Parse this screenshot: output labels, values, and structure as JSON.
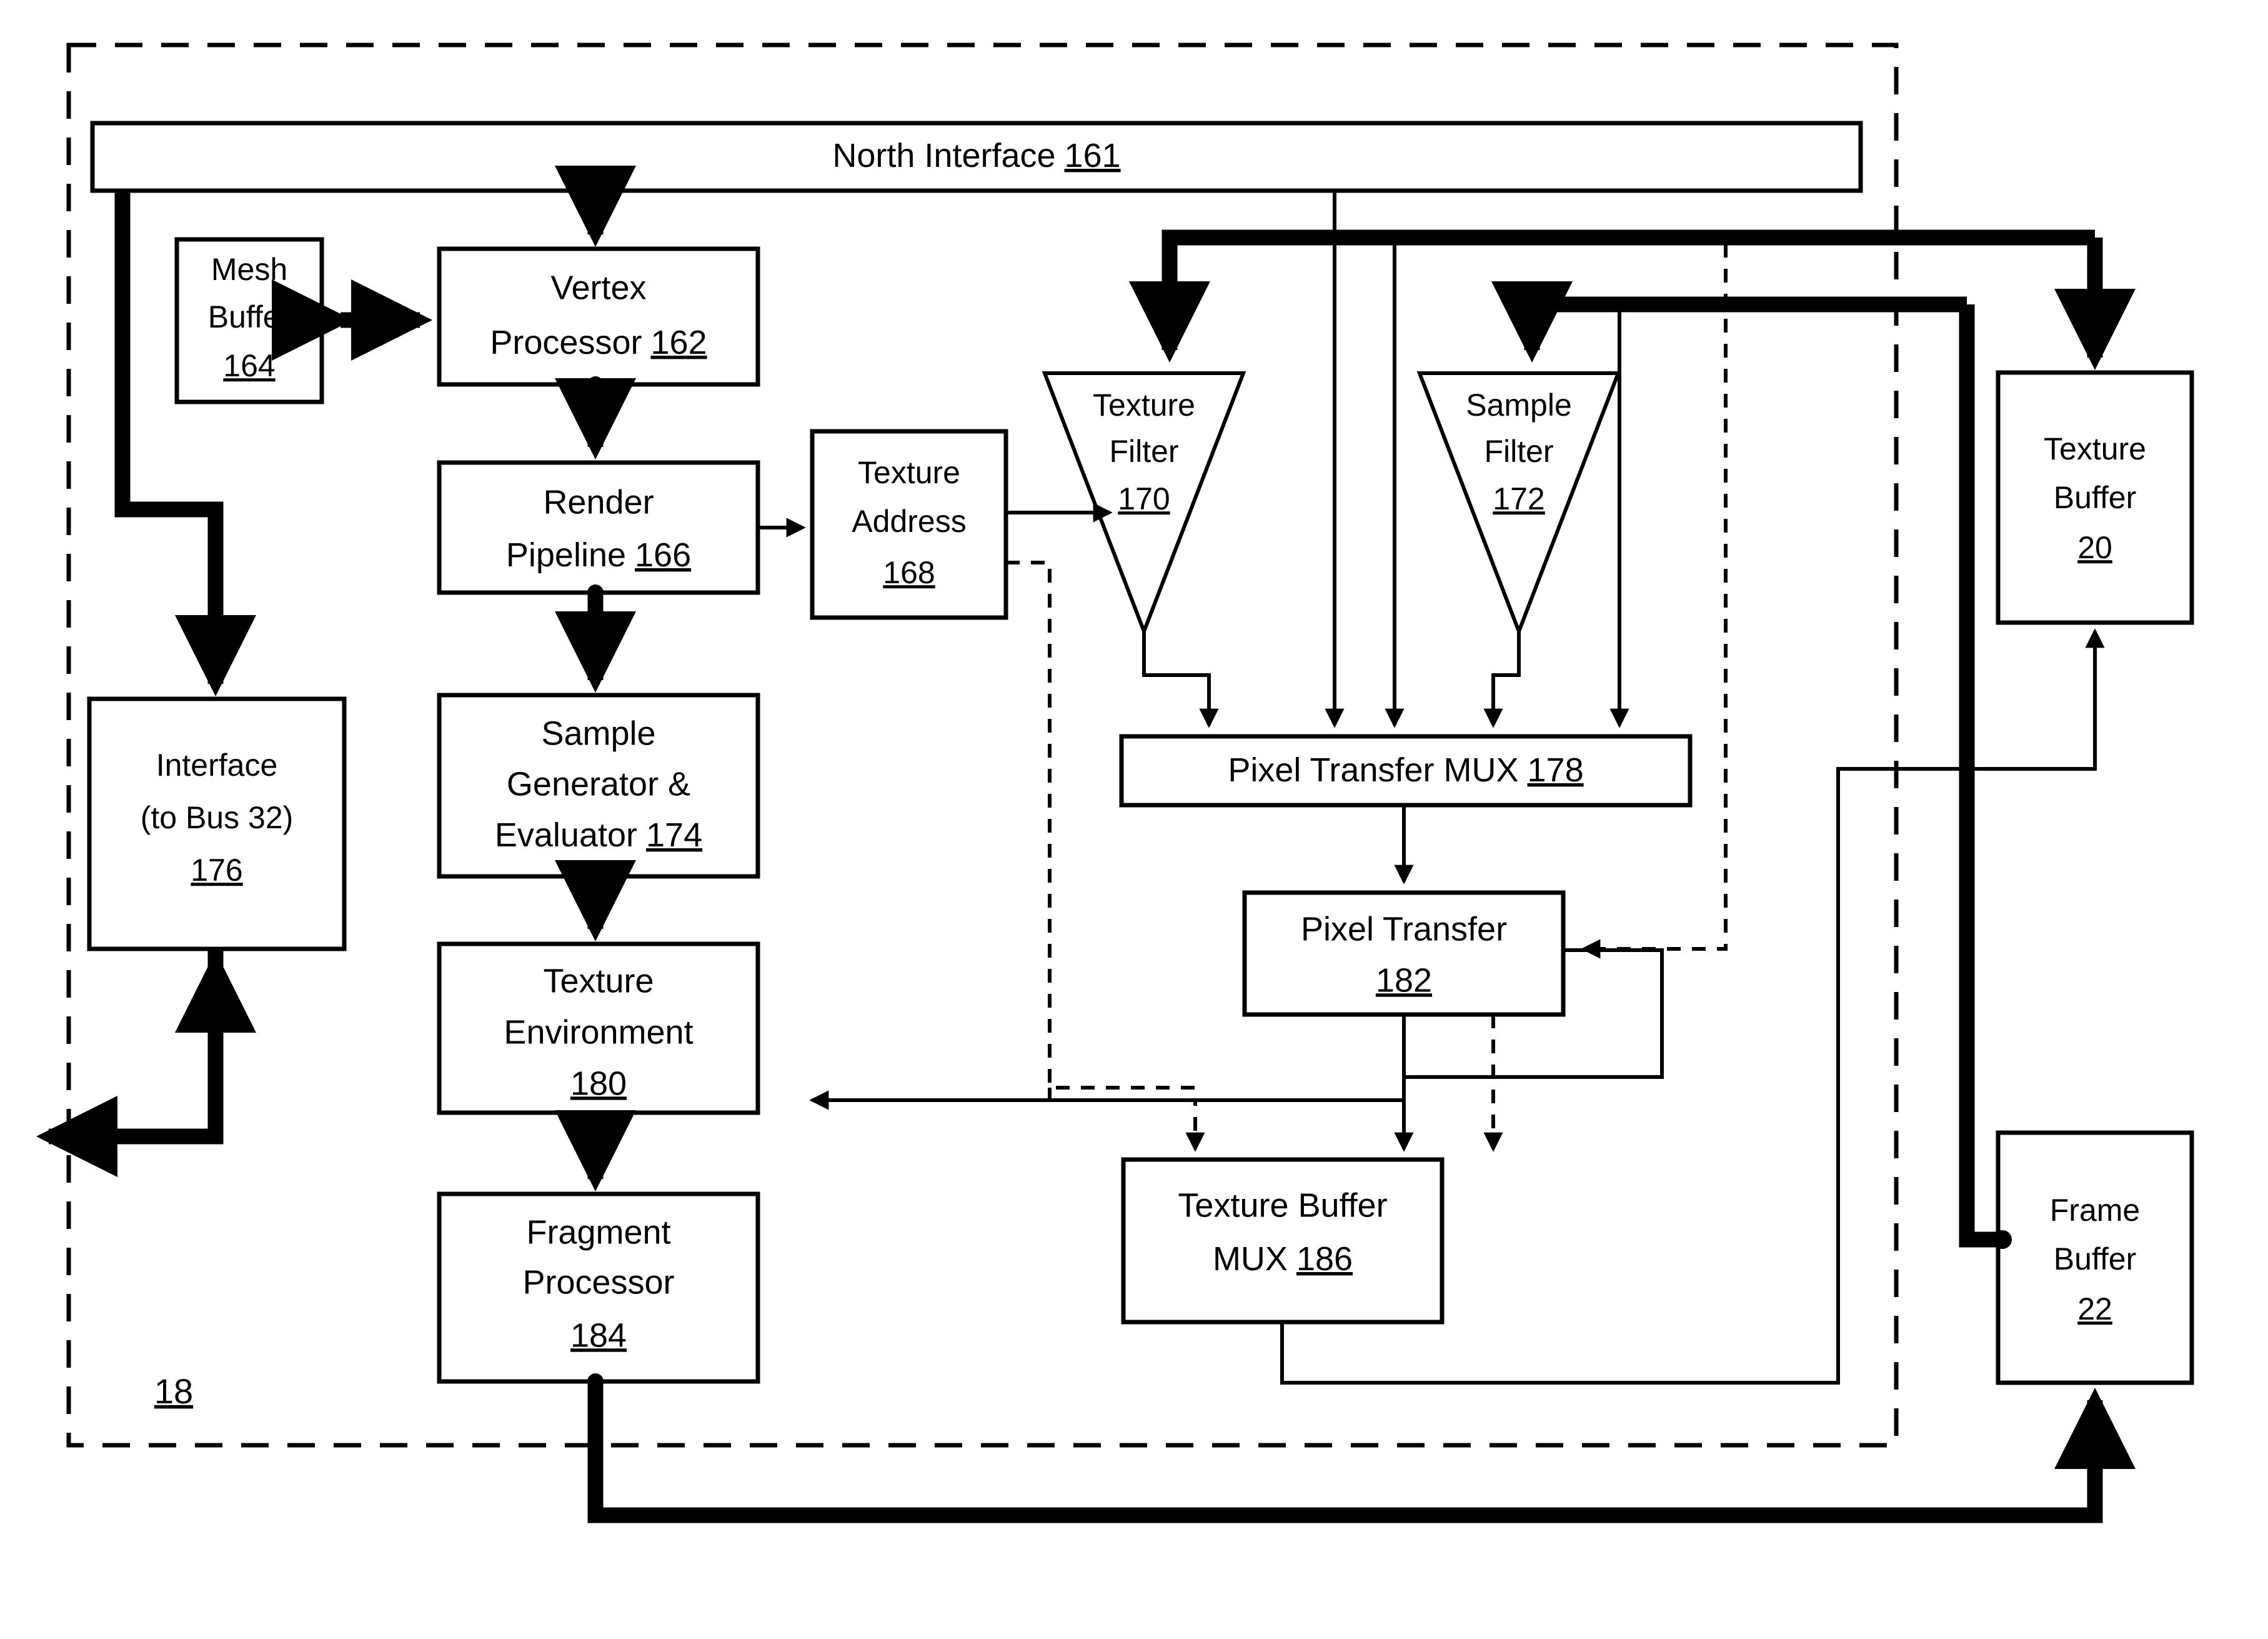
{
  "figure": {
    "container_label": "18",
    "container_style": "dashed"
  },
  "blocks": {
    "north_interface": {
      "line1": "North Interface",
      "ref": "161"
    },
    "mesh_buffer": {
      "line1": "Mesh",
      "line2": "Buffer",
      "ref": "164"
    },
    "vertex_processor": {
      "line1": "Vertex",
      "line2": "Processor",
      "ref": "162"
    },
    "render_pipeline": {
      "line1": "Render",
      "line2": "Pipeline",
      "ref": "166"
    },
    "texture_address": {
      "line1": "Texture",
      "line2": "Address",
      "ref": "168"
    },
    "texture_filter": {
      "line1": "Texture",
      "line2": "Filter",
      "ref": "170"
    },
    "sample_filter": {
      "line1": "Sample",
      "line2": "Filter",
      "ref": "172"
    },
    "texture_buffer": {
      "line1": "Texture",
      "line2": "Buffer",
      "ref": "20"
    },
    "sample_generator": {
      "line1": "Sample",
      "line2": "Generator &",
      "line3": "Evaluator",
      "ref": "174"
    },
    "interface_bus": {
      "line1": "Interface",
      "line2": "(to Bus 32)",
      "ref": "176"
    },
    "pixel_transfer_mux": {
      "line1": "Pixel Transfer MUX",
      "ref": "178"
    },
    "pixel_transfer": {
      "line1": "Pixel Transfer",
      "ref": "182"
    },
    "texture_env": {
      "line1": "Texture",
      "line2": "Environment",
      "ref": "180"
    },
    "texture_buffer_mux": {
      "line1": "Texture Buffer",
      "line2": "MUX",
      "ref": "186"
    },
    "fragment_processor": {
      "line1": "Fragment",
      "line2": "Processor",
      "ref": "184"
    },
    "frame_buffer": {
      "line1": "Frame",
      "line2": "Buffer",
      "ref": "22"
    }
  },
  "colors": {
    "ink": "#000000",
    "paper": "#ffffff"
  }
}
